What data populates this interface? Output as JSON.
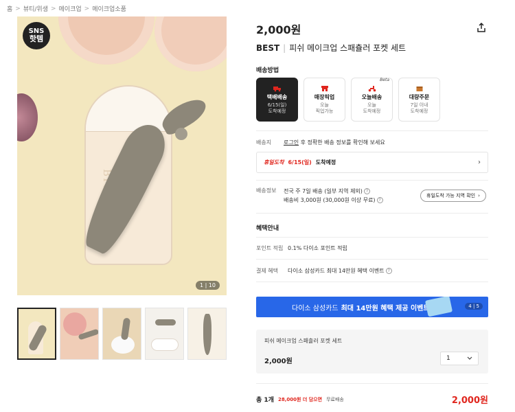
{
  "breadcrumb": [
    "홈",
    "뷰티/위생",
    "메이크업",
    "메이크업소품"
  ],
  "gallery": {
    "badge_line1": "SNS",
    "badge_line2": "핫템",
    "pouch_brand": "BICHIC",
    "counter": "1 | 10"
  },
  "product": {
    "price": "2,000원",
    "tag": "BEST",
    "name": "피쉬 메이크업 스패츌러 포켓 세트"
  },
  "shipping": {
    "section_title": "배송방법",
    "options": [
      {
        "name": "택배배송",
        "sub1": "6/15(일)",
        "sub2": "도착예정",
        "icon": "truck-icon",
        "active": true,
        "beta": ""
      },
      {
        "name": "매장픽업",
        "sub1": "오늘",
        "sub2": "픽업가능",
        "icon": "store-icon",
        "active": false,
        "beta": ""
      },
      {
        "name": "오늘배송",
        "sub1": "오늘",
        "sub2": "도착예정",
        "icon": "scooter-icon",
        "active": false,
        "beta": "Beta"
      },
      {
        "name": "대량주문",
        "sub1": "7일 이내",
        "sub2": "도착예정",
        "icon": "box-icon",
        "active": false,
        "beta": ""
      }
    ],
    "dest_label": "배송지",
    "login_link": "로그인",
    "dest_text": "후 정확한 배송 정보를 확인해 보세요",
    "arrival_brand": "휴일도착",
    "arrival_date": "6/15(일)",
    "arrival_tail": "도착예정",
    "info_label": "배송정보",
    "info_line1": "전국 주 7일 배송 (일부 지역 제외)",
    "info_line2": "배송비 3,000원 (30,000원 이상 무료)",
    "region_button": "휴일도착 가능 지역 확인"
  },
  "benefits": {
    "section_title": "혜택안내",
    "points_label": "포인트 적립",
    "points_text": "0.1% 다이소 포인트 적립",
    "payment_label": "결제 혜택",
    "payment_text": "다이소 삼성카드 최대 14만원 혜택 이벤트"
  },
  "promo": {
    "text_plain": "다이소 삼성카드",
    "text_bold": "최대 14만원 혜택 제공 이벤트",
    "pager": "4 | 5"
  },
  "option": {
    "name": "피쉬 메이크업 스패츌러 포켓 세트",
    "price": "2,000원",
    "quantity": "1"
  },
  "total": {
    "count": "총 1개",
    "more_for_free": "28,000원 더 담으면",
    "free_ship": "무료배송",
    "sum": "2,000원"
  },
  "colors": {
    "accent_red": "#e0261e",
    "promo_blue": "#2867e8",
    "dark": "#222222"
  }
}
